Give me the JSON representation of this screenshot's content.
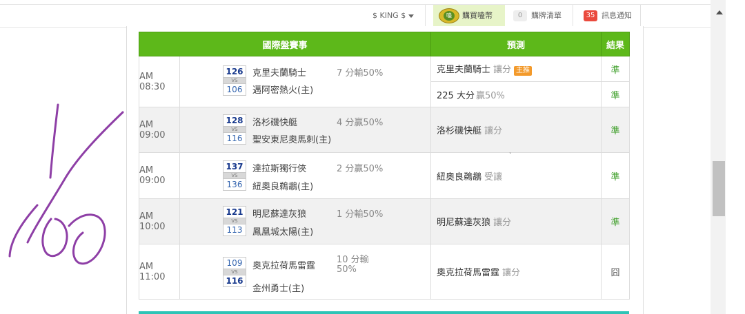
{
  "topbar": {
    "user_label": "$ KING $",
    "buy_label": "購買嗑幣",
    "coin_text": "嗑",
    "cart_count": "0",
    "cart_label": "購牌清單",
    "msg_count": "35",
    "msg_label": "訊息通知"
  },
  "table": {
    "headers": [
      "國際盤賽事",
      "預測",
      "結果"
    ],
    "rows": [
      {
        "time": "AM 08:30",
        "top_num": "126",
        "bottom_num": "106",
        "vs": "VS",
        "home": "克里夫蘭騎士",
        "away": "邁阿密熱火(主)",
        "spread_1": "7 分輸50%",
        "spread_2": "",
        "predictions": [
          {
            "team": "克里夫蘭騎士",
            "type": "讓分",
            "tag": "主推",
            "result": "準"
          },
          {
            "team": "225 大分",
            "type": "贏50%",
            "tag": "",
            "result": "準"
          }
        ]
      },
      {
        "time": "AM 09:00",
        "top_num": "128",
        "bottom_num": "116",
        "vs": "VS",
        "home": "洛杉磯快艇",
        "away": "聖安東尼奧馬刺(主)",
        "spread_1": "4 分贏50%",
        "spread_2": "",
        "predictions": [
          {
            "team": "洛杉磯快艇",
            "type": "讓分",
            "tag": "",
            "result": "準"
          }
        ]
      },
      {
        "time": "AM 09:00",
        "top_num": "137",
        "bottom_num": "136",
        "vs": "VS",
        "home": "達拉斯獨行俠",
        "away": "紐奧良鵜鶘(主)",
        "spread_1": "2 分贏50%",
        "spread_2": "",
        "predictions": [
          {
            "team": "紐奧良鵜鶘",
            "type": "受讓",
            "tag": "",
            "result": "準"
          }
        ]
      },
      {
        "time": "AM 10:00",
        "top_num": "121",
        "bottom_num": "113",
        "vs": "VS",
        "home": "明尼蘇達灰狼",
        "away": "鳳凰城太陽(主)",
        "spread_1": "1 分輸50%",
        "spread_2": "",
        "predictions": [
          {
            "team": "明尼蘇達灰狼",
            "type": "讓分",
            "tag": "",
            "result": "準"
          }
        ]
      },
      {
        "time": "AM 11:00",
        "top_num": "109",
        "bottom_num": "116",
        "vs": "VS",
        "home": "奧克拉荷馬雷霆",
        "away": "金州勇士(主)",
        "spread_1": "10 分輸",
        "spread_2": "50%",
        "predictions": [
          {
            "team": "奧克拉荷馬雷霆",
            "type": "讓分",
            "tag": "",
            "result": "囧"
          }
        ]
      }
    ]
  },
  "colors": {
    "header_green": "#5db81a",
    "result_green": "#3a9d25",
    "hot_tag": "#f39a2b",
    "badge_red": "#ea4a3d",
    "signature": "#8e3fa6"
  }
}
